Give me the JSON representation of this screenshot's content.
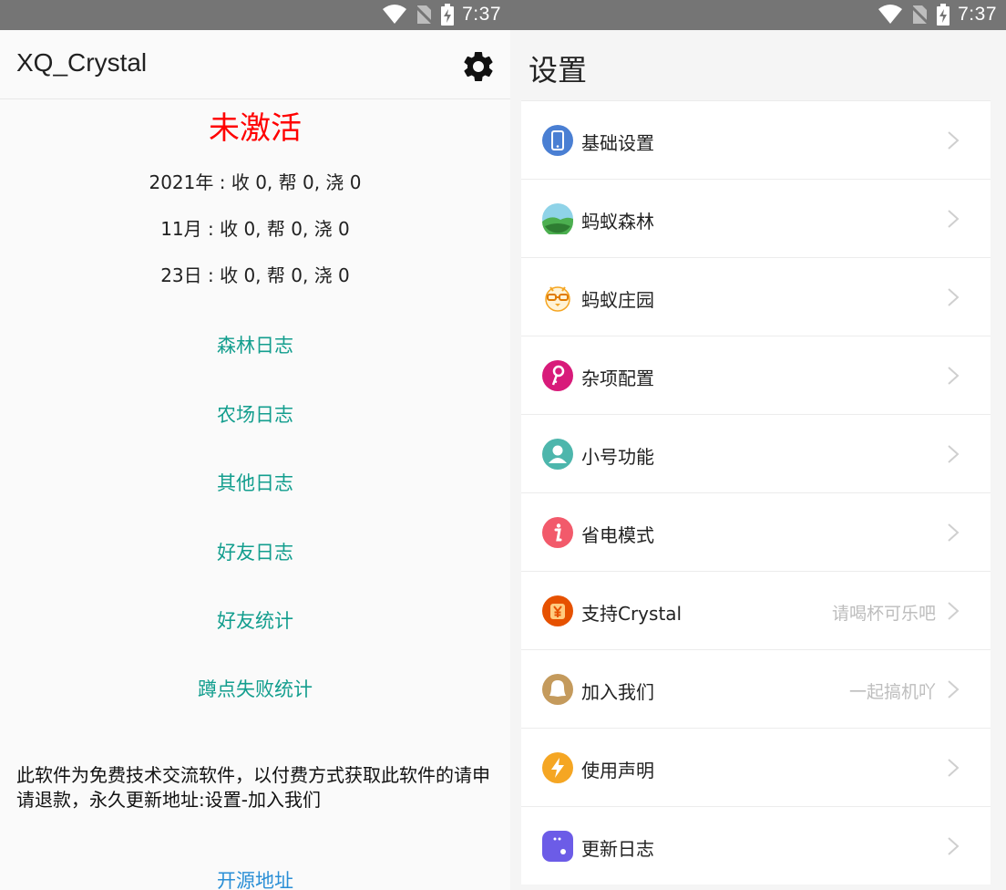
{
  "left": {
    "status_time": "7:37",
    "app_title": "XQ_Crystal",
    "status_title": "未激活",
    "stats": {
      "year": "2021年 : 收 0,  帮 0,  浇 0",
      "month": "11月 : 收 0,  帮 0,  浇 0",
      "day": "23日 : 收 0,  帮 0,  浇 0"
    },
    "links": {
      "forest_log": "森林日志",
      "farm_log": "农场日志",
      "other_log": "其他日志",
      "friend_log": "好友日志",
      "friend_stats": "好友统计",
      "fail_stats": "蹲点失败统计"
    },
    "notice": "此软件为免费技术交流软件，以付费方式获取此软件的请申请退款，永久更新地址:设置-加入我们",
    "source_link": "开源地址",
    "colors": {
      "status": "#ff0000",
      "link": "#139e8e",
      "source_link": "#2a8fd6"
    },
    "icons": {
      "settings": "gear-icon"
    }
  },
  "right": {
    "status_time": "7:37",
    "title": "设置",
    "items": [
      {
        "label": "基础设置",
        "sub": "",
        "icon": "phone-icon",
        "color": "#4a7fd3"
      },
      {
        "label": "蚂蚁森林",
        "sub": "",
        "icon": "forest-icon",
        "color": "#4caf50"
      },
      {
        "label": "蚂蚁庄园",
        "sub": "",
        "icon": "chick-icon",
        "color": "#f5a623"
      },
      {
        "label": "杂项配置",
        "sub": "",
        "icon": "key-icon",
        "color": "#d81b7a"
      },
      {
        "label": "小号功能",
        "sub": "",
        "icon": "person-icon",
        "color": "#4db6ac"
      },
      {
        "label": "省电模式",
        "sub": "",
        "icon": "info-icon",
        "color": "#f25a6b"
      },
      {
        "label": "支持Crystal",
        "sub": "请喝杯可乐吧",
        "icon": "yen-icon",
        "color": "#e65100"
      },
      {
        "label": "加入我们",
        "sub": "一起搞机吖",
        "icon": "qq-icon",
        "color": "#c49a5c"
      },
      {
        "label": "使用声明",
        "sub": "",
        "icon": "lightning-icon",
        "color": "#f5a623"
      },
      {
        "label": "更新日志",
        "sub": "",
        "icon": "dots-icon",
        "color": "#6c5ce7"
      }
    ]
  }
}
